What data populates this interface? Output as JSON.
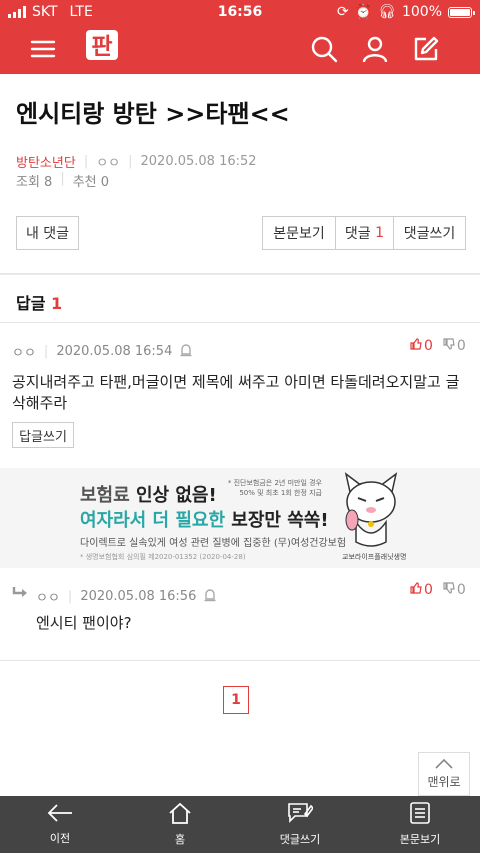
{
  "status": {
    "carrier": "SKT",
    "network": "LTE",
    "time": "16:56",
    "battery": "100%",
    "battery_fill": 1.0
  },
  "header": {
    "logo": "판",
    "icons": [
      "menu-icon",
      "search-icon",
      "user-icon",
      "write-icon"
    ]
  },
  "post": {
    "title": "엔시티랑 방탄 >>타팬<<",
    "category": "방탄소년단",
    "author": "ㅇㅇ",
    "date": "2020.05.08 16:52",
    "views": "조회 8",
    "recommends": "추천 0"
  },
  "actions": {
    "my_comments": "내 댓글",
    "view_post": "본문보기",
    "comments_label": "댓글",
    "comments_count": "1",
    "write_comment": "댓글쓰기"
  },
  "replies": {
    "header_label": "답글",
    "header_count": "1",
    "items": [
      {
        "author": "ㅇㅇ",
        "date": "2020.05.08 16:54",
        "up": "0",
        "down": "0",
        "text": "공지내려주고 타팬,머글이면 제목에 써주고 아미면 타돌데려오지말고 글삭해주라",
        "reply_button": "답글쓰기"
      },
      {
        "author": "ㅇㅇ",
        "date": "2020.05.08 16:56",
        "up": "0",
        "down": "0",
        "text": "엔시티 팬이야?"
      }
    ]
  },
  "ad": {
    "line1_a": "보험료 ",
    "line1_b": "인상 없음!",
    "line2_a": "여자라서 더 필요한 ",
    "line2_b": "보장만 쏙쏙!",
    "line3": "다이렉트로 실속있게 여성 관련 질병에 집중한 (무)여성건강보험",
    "line4": "* 생명보험협회 심의필 제2020-01352 (2020-04-28)",
    "note": "* 진단보험금은 2년 미만일 경우 50% 및 최초 1회 한정 지급",
    "brand": "교보라이프플래닛생명"
  },
  "pagination": {
    "current": "1"
  },
  "scroll_top": {
    "label": "맨위로"
  },
  "bottom_nav": [
    {
      "label": "이전",
      "icon": "back-arrow-icon"
    },
    {
      "label": "홈",
      "icon": "home-icon"
    },
    {
      "label": "댓글쓰기",
      "icon": "comment-write-icon"
    },
    {
      "label": "본문보기",
      "icon": "document-icon"
    }
  ],
  "colors": {
    "brand": "#e33c3c",
    "nav_bg": "#444444",
    "teal": "#29a6a6"
  }
}
